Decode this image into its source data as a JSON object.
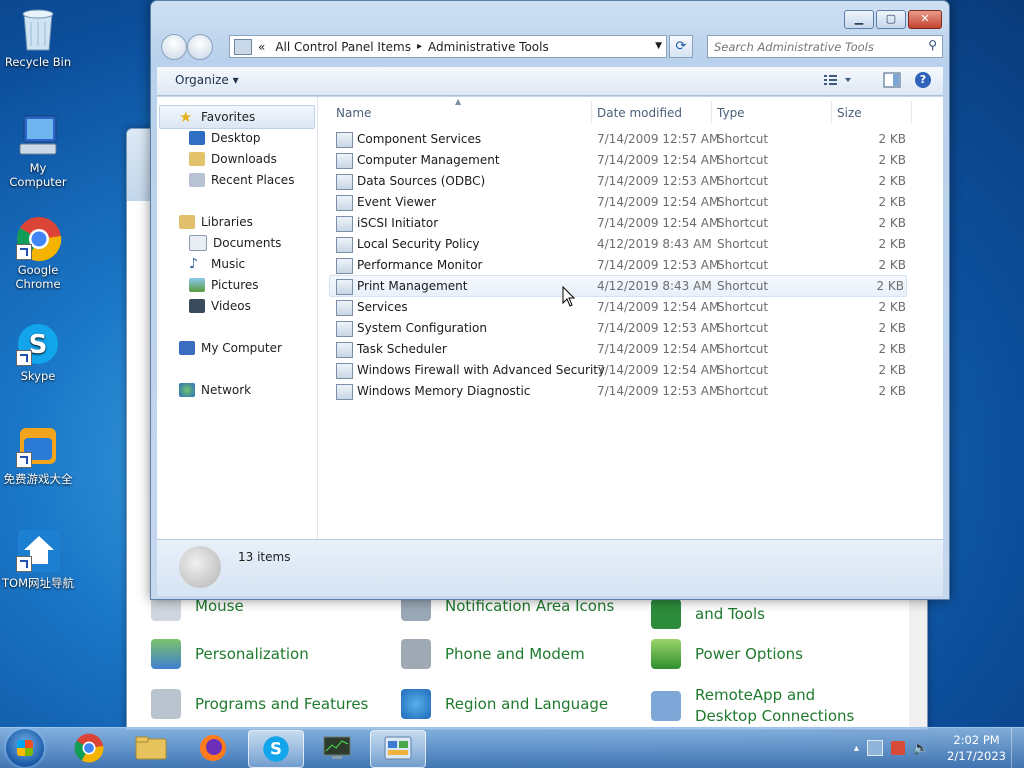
{
  "desktop": {
    "icons": [
      {
        "label": "Recycle Bin",
        "icon": "recycle-bin-icon"
      },
      {
        "label": "My Computer",
        "icon": "computer-icon"
      },
      {
        "label": "Google Chrome",
        "icon": "chrome-icon"
      },
      {
        "label": "Skype",
        "icon": "skype-icon"
      },
      {
        "label": "免费游戏大全",
        "icon": "tom-games-icon"
      },
      {
        "label": "TOM网址导航",
        "icon": "tom-nav-icon"
      }
    ]
  },
  "background_window": {
    "items": [
      {
        "label": "Mouse"
      },
      {
        "label": "Notification Area Icons"
      },
      {
        "label": "and Tools"
      },
      {
        "label": "Personalization"
      },
      {
        "label": "Phone and Modem"
      },
      {
        "label": "Power Options"
      },
      {
        "label": "Programs and Features"
      },
      {
        "label": "Region and Language"
      },
      {
        "label": "RemoteApp and Desktop Connections"
      }
    ]
  },
  "explorer": {
    "caption": {
      "minimize": "▁",
      "maximize": "▢",
      "close": "✕"
    },
    "address": {
      "prefix": "«",
      "crumbs": [
        "All Control Panel Items",
        "Administrative Tools"
      ],
      "separator": "▸"
    },
    "search": {
      "placeholder": "Search Administrative Tools"
    },
    "toolbar": {
      "organize": "Organize",
      "organize_arrow": "▾"
    },
    "nav": {
      "favorites": "Favorites",
      "desktop": "Desktop",
      "downloads": "Downloads",
      "recent": "Recent Places",
      "libraries": "Libraries",
      "documents": "Documents",
      "music": "Music",
      "pictures": "Pictures",
      "videos": "Videos",
      "computer": "My Computer",
      "network": "Network"
    },
    "columns": {
      "name": "Name",
      "date": "Date modified",
      "type": "Type",
      "size": "Size"
    },
    "files": [
      {
        "name": "Component Services",
        "date": "7/14/2009 12:57 AM",
        "type": "Shortcut",
        "size": "2 KB"
      },
      {
        "name": "Computer Management",
        "date": "7/14/2009 12:54 AM",
        "type": "Shortcut",
        "size": "2 KB"
      },
      {
        "name": "Data Sources (ODBC)",
        "date": "7/14/2009 12:53 AM",
        "type": "Shortcut",
        "size": "2 KB"
      },
      {
        "name": "Event Viewer",
        "date": "7/14/2009 12:54 AM",
        "type": "Shortcut",
        "size": "2 KB"
      },
      {
        "name": "iSCSI Initiator",
        "date": "7/14/2009 12:54 AM",
        "type": "Shortcut",
        "size": "2 KB"
      },
      {
        "name": "Local Security Policy",
        "date": "4/12/2019 8:43 AM",
        "type": "Shortcut",
        "size": "2 KB"
      },
      {
        "name": "Performance Monitor",
        "date": "7/14/2009 12:53 AM",
        "type": "Shortcut",
        "size": "2 KB"
      },
      {
        "name": "Print Management",
        "date": "4/12/2019 8:43 AM",
        "type": "Shortcut",
        "size": "2 KB"
      },
      {
        "name": "Services",
        "date": "7/14/2009 12:54 AM",
        "type": "Shortcut",
        "size": "2 KB"
      },
      {
        "name": "System Configuration",
        "date": "7/14/2009 12:53 AM",
        "type": "Shortcut",
        "size": "2 KB"
      },
      {
        "name": "Task Scheduler",
        "date": "7/14/2009 12:54 AM",
        "type": "Shortcut",
        "size": "2 KB"
      },
      {
        "name": "Windows Firewall with Advanced Security",
        "date": "7/14/2009 12:54 AM",
        "type": "Shortcut",
        "size": "2 KB"
      },
      {
        "name": "Windows Memory Diagnostic",
        "date": "7/14/2009 12:53 AM",
        "type": "Shortcut",
        "size": "2 KB"
      }
    ],
    "status": {
      "count": "13 items"
    }
  },
  "taskbar": {
    "clock": {
      "time": "2:02 PM",
      "date": "2/17/2023"
    },
    "tray_arrow": "▴"
  }
}
